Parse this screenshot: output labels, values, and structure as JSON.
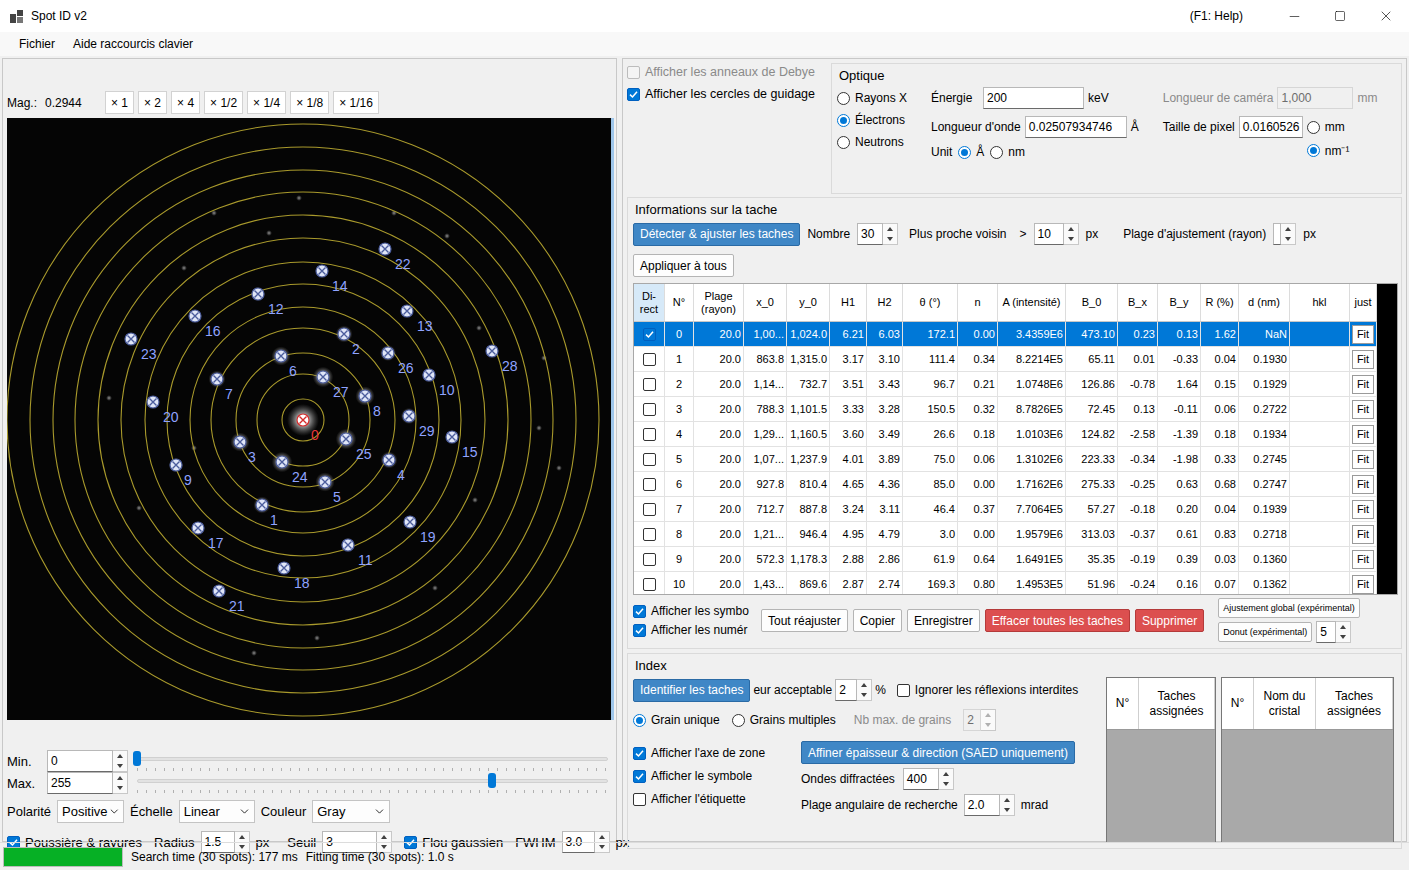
{
  "window": {
    "title": "Spot ID v2",
    "help": "(F1: Help)"
  },
  "menu": [
    {
      "label": "Fichier"
    },
    {
      "label": "Aide raccourcis clavier"
    }
  ],
  "viewer": {
    "mag_label": "Mag.:",
    "mag_value": "0.2944",
    "zoom_buttons": [
      "× 1",
      "× 2",
      "× 4",
      "× 1/2",
      "× 1/4",
      "× 1/8",
      "× 1/16"
    ],
    "spots": [
      {
        "label": "0",
        "direct": true
      },
      {
        "label": "1",
        "direct": false
      },
      {
        "label": "2",
        "direct": false
      },
      {
        "label": "3",
        "direct": false
      },
      {
        "label": "4",
        "direct": false
      },
      {
        "label": "5",
        "direct": false
      },
      {
        "label": "6",
        "direct": false
      },
      {
        "label": "7",
        "direct": false
      },
      {
        "label": "8",
        "direct": false
      },
      {
        "label": "9",
        "direct": false
      },
      {
        "label": "10",
        "direct": false
      },
      {
        "label": "11",
        "direct": false
      },
      {
        "label": "12",
        "direct": false
      },
      {
        "label": "13",
        "direct": false
      },
      {
        "label": "14",
        "direct": false
      },
      {
        "label": "15",
        "direct": false
      },
      {
        "label": "16",
        "direct": false
      },
      {
        "label": "17",
        "direct": false
      },
      {
        "label": "18",
        "direct": false
      },
      {
        "label": "19",
        "direct": false
      },
      {
        "label": "20",
        "direct": false
      },
      {
        "label": "21",
        "direct": false
      },
      {
        "label": "22",
        "direct": false
      },
      {
        "label": "23",
        "direct": false
      },
      {
        "label": "24",
        "direct": false
      },
      {
        "label": "25",
        "direct": false
      },
      {
        "label": "26",
        "direct": false
      },
      {
        "label": "27",
        "direct": false
      },
      {
        "label": "28",
        "direct": false
      },
      {
        "label": "29",
        "direct": false
      }
    ],
    "min": {
      "label": "Min.",
      "value": "0",
      "level": 0
    },
    "max": {
      "label": "Max.",
      "value": "255",
      "level": 0.754
    },
    "polarity": {
      "label": "Polarité",
      "value": "Positive"
    },
    "scale": {
      "label": "Échelle",
      "value": "Linear"
    },
    "color": {
      "label": "Couleur",
      "value": "Gray"
    },
    "dust": {
      "label": "Poussière & rayures",
      "checked": true
    },
    "radius": {
      "label": "Radius",
      "value": "1.5",
      "unit": "px"
    },
    "threshold": {
      "label": "Seuil",
      "value": "3"
    },
    "blur": {
      "label": "Flou gaussien",
      "checked": true
    },
    "fwhm": {
      "label": "FWHM",
      "value": "3.0",
      "unit": "px"
    }
  },
  "display": [
    {
      "label": "Afficher les anneaux de Debye",
      "checked": false,
      "disabled": true
    },
    {
      "label": "Afficher les cercles de guidage",
      "checked": true,
      "disabled": false
    }
  ],
  "optics": {
    "title": "Optique",
    "sources": [
      {
        "label": "Rayons X",
        "selected": false
      },
      {
        "label": "Électrons",
        "selected": true
      },
      {
        "label": "Neutrons",
        "selected": false
      }
    ],
    "energy": {
      "label": "Énergie",
      "value": "200",
      "unit": "keV"
    },
    "wavelength": {
      "label": "Longueur d'onde",
      "value": "0.02507934746",
      "unit": "Å"
    },
    "unit": {
      "label": "Unit",
      "options": [
        {
          "label": "Å",
          "selected": true
        },
        {
          "label": "nm",
          "selected": false
        }
      ]
    },
    "camera": {
      "label": "Longueur de caméra",
      "value": "1,000",
      "unit": "mm",
      "disabled": true
    },
    "pixel": {
      "label": "Taille de pixel",
      "value": "0.0160526",
      "options": [
        {
          "label": "mm",
          "selected": false
        },
        {
          "label": "nm⁻¹",
          "selected": true
        }
      ]
    }
  },
  "spot_info": {
    "title": "Informations sur la tache",
    "detect_button": "Détecter & ajuster les taches",
    "count": {
      "label": "Nombre",
      "value": "30"
    },
    "neighbor": {
      "label": "Plus proche voisin",
      "op": ">",
      "value": "10",
      "unit": "px"
    },
    "fit_range": {
      "label": "Plage d'ajustement (rayon)",
      "value": "",
      "unit": "px"
    },
    "apply_button": "Appliquer à tous",
    "table": {
      "columns": [
        "Di-rect",
        "N°",
        "Plage (rayon)",
        "x_0",
        "y_0",
        "H1",
        "H2",
        "θ (°)",
        "n",
        "A (intensité)",
        "B_0",
        "B_x",
        "B_y",
        "R (%)",
        "d (nm)",
        "hkl",
        "just"
      ],
      "rows": [
        {
          "direct": true,
          "selected": true,
          "fit": "Fit",
          "cells": [
            "0",
            "20.0",
            "1,00...",
            "1,024.0",
            "6.21",
            "6.03",
            "172.1",
            "0.00",
            "3.4359E6",
            "473.10",
            "0.23",
            "0.13",
            "1.62",
            "NaN",
            ""
          ]
        },
        {
          "direct": false,
          "selected": false,
          "fit": "Fit",
          "cells": [
            "1",
            "20.0",
            "863.8",
            "1,315.0",
            "3.17",
            "3.10",
            "111.4",
            "0.34",
            "8.2214E5",
            "65.11",
            "0.01",
            "-0.33",
            "0.04",
            "0.1930",
            ""
          ]
        },
        {
          "direct": false,
          "selected": false,
          "fit": "Fit",
          "cells": [
            "2",
            "20.0",
            "1,14...",
            "732.7",
            "3.51",
            "3.43",
            "96.7",
            "0.21",
            "1.0748E6",
            "126.86",
            "-0.78",
            "1.64",
            "0.15",
            "0.1929",
            ""
          ]
        },
        {
          "direct": false,
          "selected": false,
          "fit": "Fit",
          "cells": [
            "3",
            "20.0",
            "788.3",
            "1,101.5",
            "3.33",
            "3.28",
            "150.5",
            "0.32",
            "8.7826E5",
            "72.45",
            "0.13",
            "-0.11",
            "0.06",
            "0.2722",
            ""
          ]
        },
        {
          "direct": false,
          "selected": false,
          "fit": "Fit",
          "cells": [
            "4",
            "20.0",
            "1,29...",
            "1,160.5",
            "3.60",
            "3.49",
            "26.6",
            "0.18",
            "1.0103E6",
            "124.82",
            "-2.58",
            "-1.39",
            "0.18",
            "0.1934",
            ""
          ]
        },
        {
          "direct": false,
          "selected": false,
          "fit": "Fit",
          "cells": [
            "5",
            "20.0",
            "1,07...",
            "1,237.9",
            "4.01",
            "3.89",
            "75.0",
            "0.06",
            "1.3102E6",
            "223.33",
            "-0.34",
            "-1.98",
            "0.33",
            "0.2745",
            ""
          ]
        },
        {
          "direct": false,
          "selected": false,
          "fit": "Fit",
          "cells": [
            "6",
            "20.0",
            "927.8",
            "810.4",
            "4.65",
            "4.36",
            "85.0",
            "0.00",
            "1.7162E6",
            "275.33",
            "-0.25",
            "0.63",
            "0.68",
            "0.2747",
            ""
          ]
        },
        {
          "direct": false,
          "selected": false,
          "fit": "Fit",
          "cells": [
            "7",
            "20.0",
            "712.7",
            "887.8",
            "3.24",
            "3.11",
            "46.4",
            "0.37",
            "7.7064E5",
            "57.27",
            "-0.18",
            "0.20",
            "0.04",
            "0.1939",
            ""
          ]
        },
        {
          "direct": false,
          "selected": false,
          "fit": "Fit",
          "cells": [
            "8",
            "20.0",
            "1,21...",
            "946.4",
            "4.95",
            "4.79",
            "3.0",
            "0.00",
            "1.9579E6",
            "313.03",
            "-0.37",
            "0.61",
            "0.83",
            "0.2718",
            ""
          ]
        },
        {
          "direct": false,
          "selected": false,
          "fit": "Fit",
          "cells": [
            "9",
            "20.0",
            "572.3",
            "1,178.3",
            "2.88",
            "2.86",
            "61.9",
            "0.64",
            "1.6491E5",
            "35.35",
            "-0.19",
            "0.39",
            "0.03",
            "0.1360",
            ""
          ]
        },
        {
          "direct": false,
          "selected": false,
          "fit": "Fit",
          "cells": [
            "10",
            "20.0",
            "1,43...",
            "869.6",
            "2.87",
            "2.74",
            "169.3",
            "0.80",
            "1.4953E5",
            "51.96",
            "-0.24",
            "0.16",
            "0.07",
            "0.1362",
            ""
          ]
        }
      ]
    },
    "show_symbols": {
      "label": "Afficher les symbo",
      "checked": true
    },
    "show_numbers": {
      "label": "Afficher les numér",
      "checked": true
    },
    "buttons": [
      {
        "label": "Tout réajuster",
        "kind": "normal"
      },
      {
        "label": "Copier",
        "kind": "normal"
      },
      {
        "label": "Enregistrer",
        "kind": "normal"
      },
      {
        "label": "Effacer toutes les taches",
        "kind": "danger"
      },
      {
        "label": "Supprimer",
        "kind": "danger"
      }
    ],
    "global_fit": "Ajustement global  (expérimental)",
    "donut": {
      "label": "Donut  (expérimental)",
      "value": "5"
    }
  },
  "index": {
    "title": "Index",
    "identify_button": "Identifier les taches",
    "tolerance": {
      "label": "eur acceptable",
      "value": "2",
      "unit": "%"
    },
    "ignore_forbidden": {
      "label": "Ignorer les réflexions interdites",
      "checked": false
    },
    "grain_modes": [
      {
        "label": "Grain unique",
        "selected": true
      },
      {
        "label": "Grains multiples",
        "selected": false
      }
    ],
    "max_grains": {
      "label": "Nb max. de grains",
      "value": "2",
      "disabled": true
    },
    "options": [
      {
        "label": "Afficher l'axe de zone",
        "checked": true
      },
      {
        "label": "Afficher le symbole",
        "checked": true
      },
      {
        "label": "Afficher l'étiquette",
        "checked": false
      }
    ],
    "refine_button": "Affiner épaisseur & direction (SAED uniquement)",
    "waves": {
      "label": "Ondes diffractées",
      "value": "400"
    },
    "angle_range": {
      "label": "Plage angulaire de recherche",
      "value": "2.0",
      "unit": "mrad"
    },
    "grain_table": {
      "columns": [
        "N°",
        "Taches assignées"
      ]
    },
    "crystal_table": {
      "columns": [
        "N°",
        "Nom du cristal",
        "Taches assignées"
      ]
    }
  },
  "status": {
    "progress": 1,
    "search": "Search time (30 spots): 177 ms",
    "fitting": "Fitting time (30 spots): 1.0 s"
  }
}
